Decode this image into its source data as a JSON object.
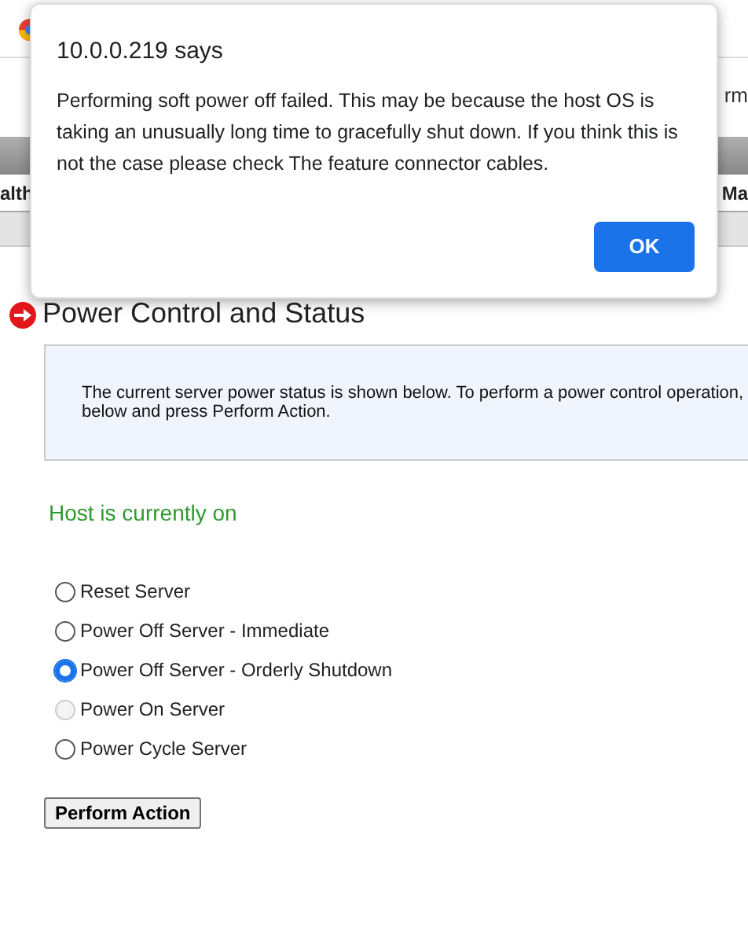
{
  "header": {
    "right_fragment": "rm"
  },
  "nav": {
    "left_fragment": "alth",
    "right_fragment": "Ma"
  },
  "page_title": "Power Control and Status",
  "info_text": "The current server power status is shown below. To perform a power control operation, below and press Perform Action.",
  "status": "Host is currently on",
  "options": [
    {
      "label": "Reset Server",
      "selected": false,
      "disabled": false
    },
    {
      "label": "Power Off Server - Immediate",
      "selected": false,
      "disabled": false
    },
    {
      "label": "Power Off Server - Orderly Shutdown",
      "selected": true,
      "disabled": false
    },
    {
      "label": "Power On Server",
      "selected": false,
      "disabled": true
    },
    {
      "label": "Power Cycle Server",
      "selected": false,
      "disabled": false
    }
  ],
  "action_button": "Perform Action",
  "dialog": {
    "title": "10.0.0.219 says",
    "message": "Performing soft power off failed. This may be because the host OS is taking an unusually long time to gracefully shut down. If you think this is not the case please check  The feature connector cables.",
    "button": "OK"
  }
}
